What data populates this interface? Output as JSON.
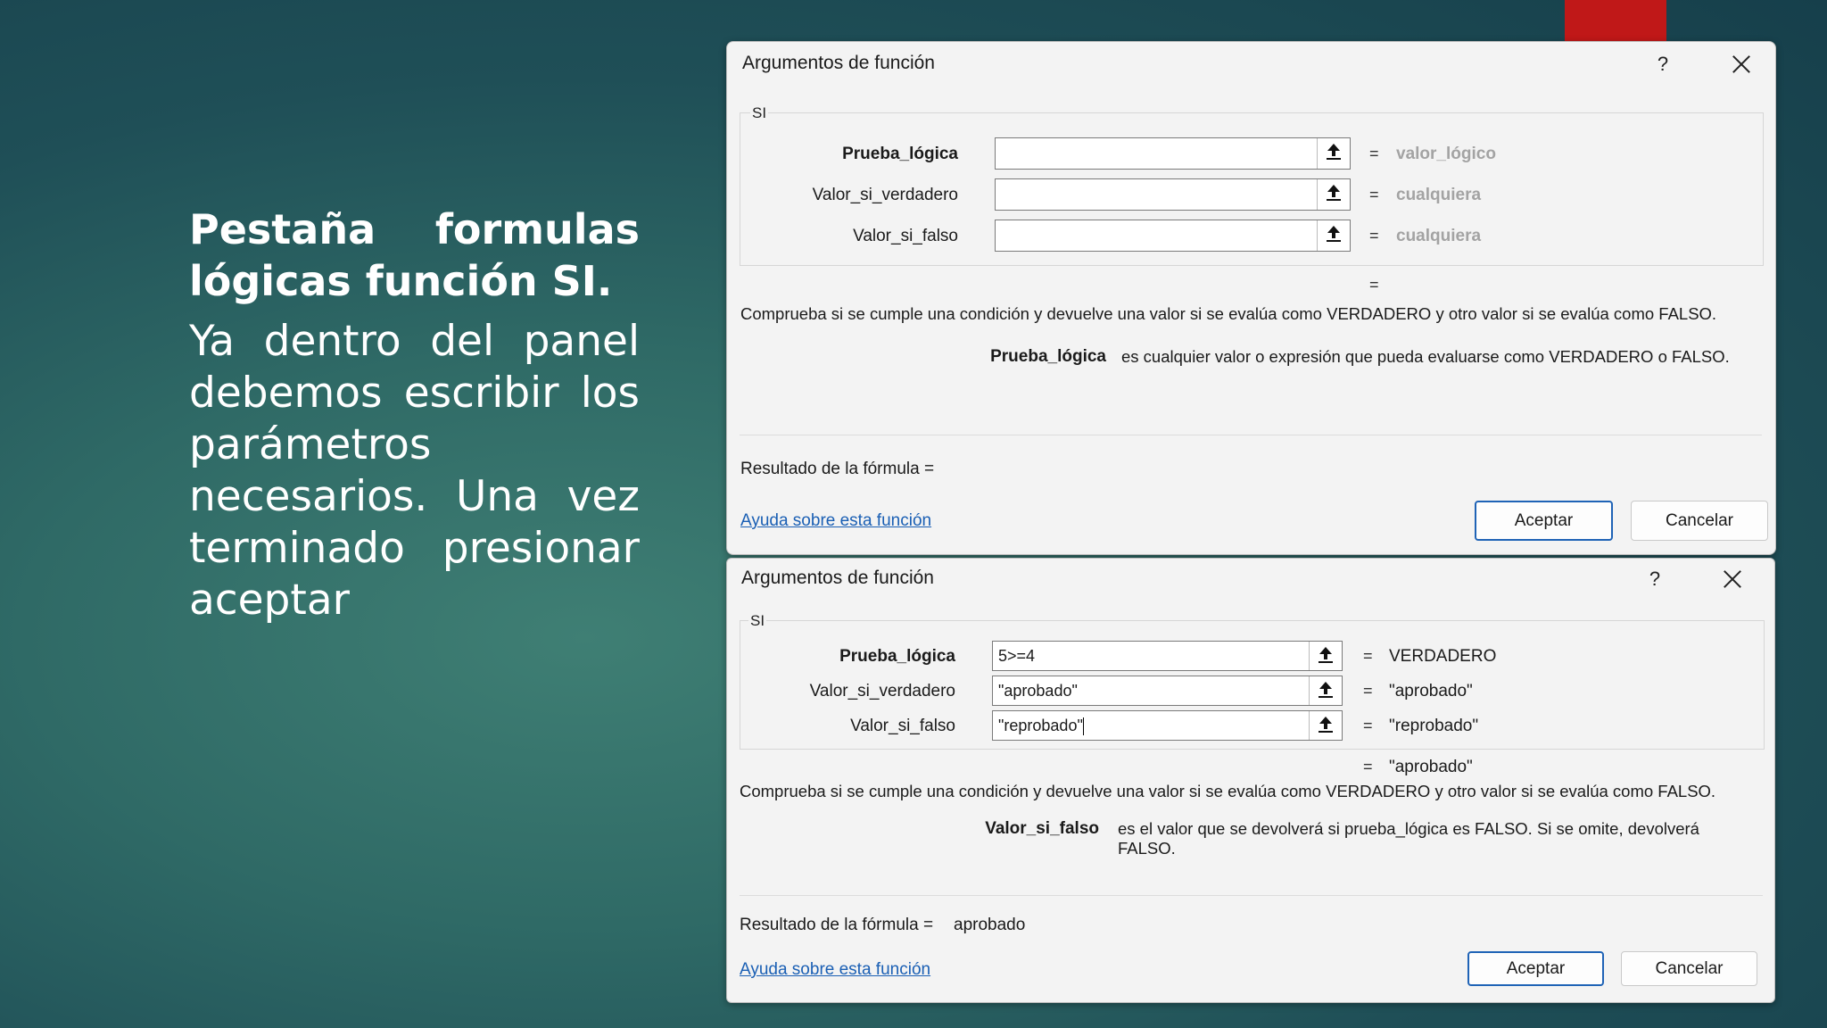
{
  "slide": {
    "title": "Pestaña formulas lógicas función SI.",
    "body": "Ya dentro del panel debemos escribir los parámetros necesarios. Una vez terminado presionar aceptar"
  },
  "dialog1": {
    "title": "Argumentos de función",
    "help": "?",
    "function_name": "SI",
    "args": [
      {
        "label": "Prueba_lógica",
        "value": "",
        "result": "valor_lógico"
      },
      {
        "label": "Valor_si_verdadero",
        "value": "",
        "result": "cualquiera"
      },
      {
        "label": "Valor_si_falso",
        "value": "",
        "result": "cualquiera"
      }
    ],
    "eq": "=",
    "overall_result": "",
    "description": "Comprueba si se cumple una condición y devuelve una valor si se evalúa como VERDADERO y otro valor si se evalúa como FALSO.",
    "param_name": "Prueba_lógica",
    "param_desc": "es cualquier valor o expresión que pueda evaluarse como VERDADERO o FALSO.",
    "formula_result_label": "Resultado de la fórmula =",
    "formula_result": "",
    "help_link": "Ayuda sobre esta función",
    "ok": "Aceptar",
    "cancel": "Cancelar"
  },
  "dialog2": {
    "title": "Argumentos de función",
    "help": "?",
    "function_name": "SI",
    "args": [
      {
        "label": "Prueba_lógica",
        "value": "5>=4",
        "result": "VERDADERO"
      },
      {
        "label": "Valor_si_verdadero",
        "value": "\"aprobado\"",
        "result": "\"aprobado\""
      },
      {
        "label": "Valor_si_falso",
        "value": "\"reprobado\"",
        "result": "\"reprobado\""
      }
    ],
    "eq": "=",
    "overall_result": "\"aprobado\"",
    "description": "Comprueba si se cumple una condición y devuelve una valor si se evalúa como VERDADERO y otro valor si se evalúa como FALSO.",
    "param_name": "Valor_si_falso",
    "param_desc": "es el valor que se devolverá si prueba_lógica es FALSO. Si se omite, devolverá FALSO.",
    "formula_result_label": "Resultado de la fórmula =",
    "formula_result": "aprobado",
    "help_link": "Ayuda sobre esta función",
    "ok": "Aceptar",
    "cancel": "Cancelar"
  }
}
